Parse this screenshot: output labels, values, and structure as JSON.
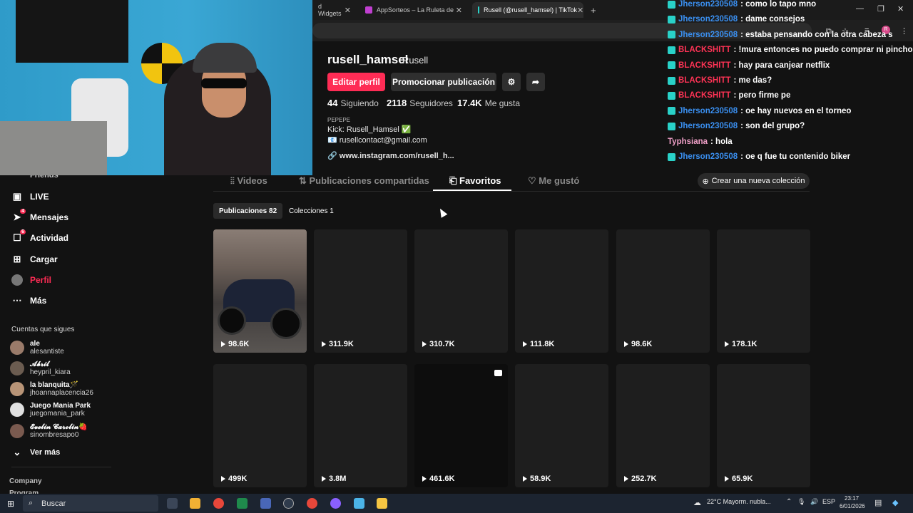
{
  "browser": {
    "tabs": [
      {
        "label": "d Widgets"
      },
      {
        "label": "AppSorteos – La Ruleta de la S"
      },
      {
        "label": "Rusell (@rusell_hamsel) | TikTok",
        "active": true
      }
    ],
    "new_tab_icon": "plus-icon"
  },
  "profile": {
    "username": "rusell_hamsel",
    "nickname": "Rusell",
    "edit_label": "Editar perfil",
    "promote_label": "Promocionar publicación",
    "stats": [
      {
        "value": "44",
        "label": "Siguiendo"
      },
      {
        "value": "2118",
        "label": "Seguidores"
      },
      {
        "value": "17.4K",
        "label": "Me gusta"
      }
    ],
    "bio_header": "PEPEPE",
    "bio_line1": "Kick: Rusell_Hamsel ✅",
    "bio_line2": "📧 rusellcontact@gmail.com",
    "link": "www.instagram.com/rusell_h..."
  },
  "content_tabs": [
    {
      "label": "Videos"
    },
    {
      "label": "Publicaciones compartidas"
    },
    {
      "label": "Favoritos",
      "active": true
    },
    {
      "label": "Me gustó"
    }
  ],
  "new_collection_label": "Crear una nueva colección",
  "subtabs": [
    {
      "label": "Publicaciones 82",
      "active": true
    },
    {
      "label": "Colecciones 1"
    }
  ],
  "videos": [
    {
      "views": "98.6K"
    },
    {
      "views": "311.9K"
    },
    {
      "views": "310.7K"
    },
    {
      "views": "111.8K"
    },
    {
      "views": "98.6K"
    },
    {
      "views": "178.1K"
    },
    {
      "views": "499K"
    },
    {
      "views": "3.8M"
    },
    {
      "views": "461.6K"
    },
    {
      "views": "58.9K"
    },
    {
      "views": "252.7K"
    },
    {
      "views": "65.9K"
    }
  ],
  "sidebar": {
    "partial_item": "Friends",
    "items": [
      {
        "label": "LIVE",
        "icon": "live-icon"
      },
      {
        "label": "Mensajes",
        "icon": "messages-icon",
        "badge": "4"
      },
      {
        "label": "Actividad",
        "icon": "activity-icon",
        "badge": "6"
      },
      {
        "label": "Cargar",
        "icon": "upload-icon"
      },
      {
        "label": "Perfil",
        "icon": "profile-avatar",
        "active": true
      },
      {
        "label": "Más",
        "icon": "more-icon"
      }
    ],
    "following_title": "Cuentas que sigues",
    "following": [
      {
        "name": "ale",
        "handle": "alesantiste"
      },
      {
        "name": "𝓐𝓫𝓻𝓲𝓵",
        "handle": "heypril_kiara"
      },
      {
        "name": "la blanquita🪄",
        "handle": "jhoannaplacencia26"
      },
      {
        "name": "Juego Mania Park",
        "handle": "juegomania_park"
      },
      {
        "name": "𝓔𝓿𝓮𝓵𝓲𝓷 𝓒𝓪𝓻𝓸𝓵𝓲𝓷🍓",
        "handle": "sinombresapo0"
      }
    ],
    "see_more": "Ver más",
    "company": "Company",
    "program": "Program"
  },
  "chat": [
    {
      "user": "Jherson230508",
      "msg": ": como lo tapo mno",
      "color": "blue"
    },
    {
      "user": "Jherson230508",
      "msg": ": dame consejos",
      "color": "blue"
    },
    {
      "user": "Jherson230508",
      "msg": ": estaba pensando con la otra cabeza s",
      "color": "blue"
    },
    {
      "user": "BLACKSHITT",
      "msg": ": !mura entonces no puedo comprar ni pincho",
      "color": "red"
    },
    {
      "user": "BLACKSHITT",
      "msg": ": hay para canjear netflix",
      "color": "red"
    },
    {
      "user": "BLACKSHITT",
      "msg": ": me das?",
      "color": "red"
    },
    {
      "user": "BLACKSHITT",
      "msg": ": pero firme pe",
      "color": "red"
    },
    {
      "user": "Jherson230508",
      "msg": ": oe hay nuevos en el torneo",
      "color": "blue"
    },
    {
      "user": "Jherson230508",
      "msg": ": son del grupo?",
      "color": "blue"
    },
    {
      "user": "Typhsiana",
      "msg": ": hola",
      "color": "pink"
    },
    {
      "user": "Jherson230508",
      "msg": ": oe q fue tu contenido biker",
      "color": "blue"
    }
  ],
  "taskbar": {
    "search_placeholder": "Buscar",
    "weather": "22°C  Mayorm. nubla...",
    "lang": "ESP",
    "time": "23:17",
    "date": "6/01/2026"
  }
}
